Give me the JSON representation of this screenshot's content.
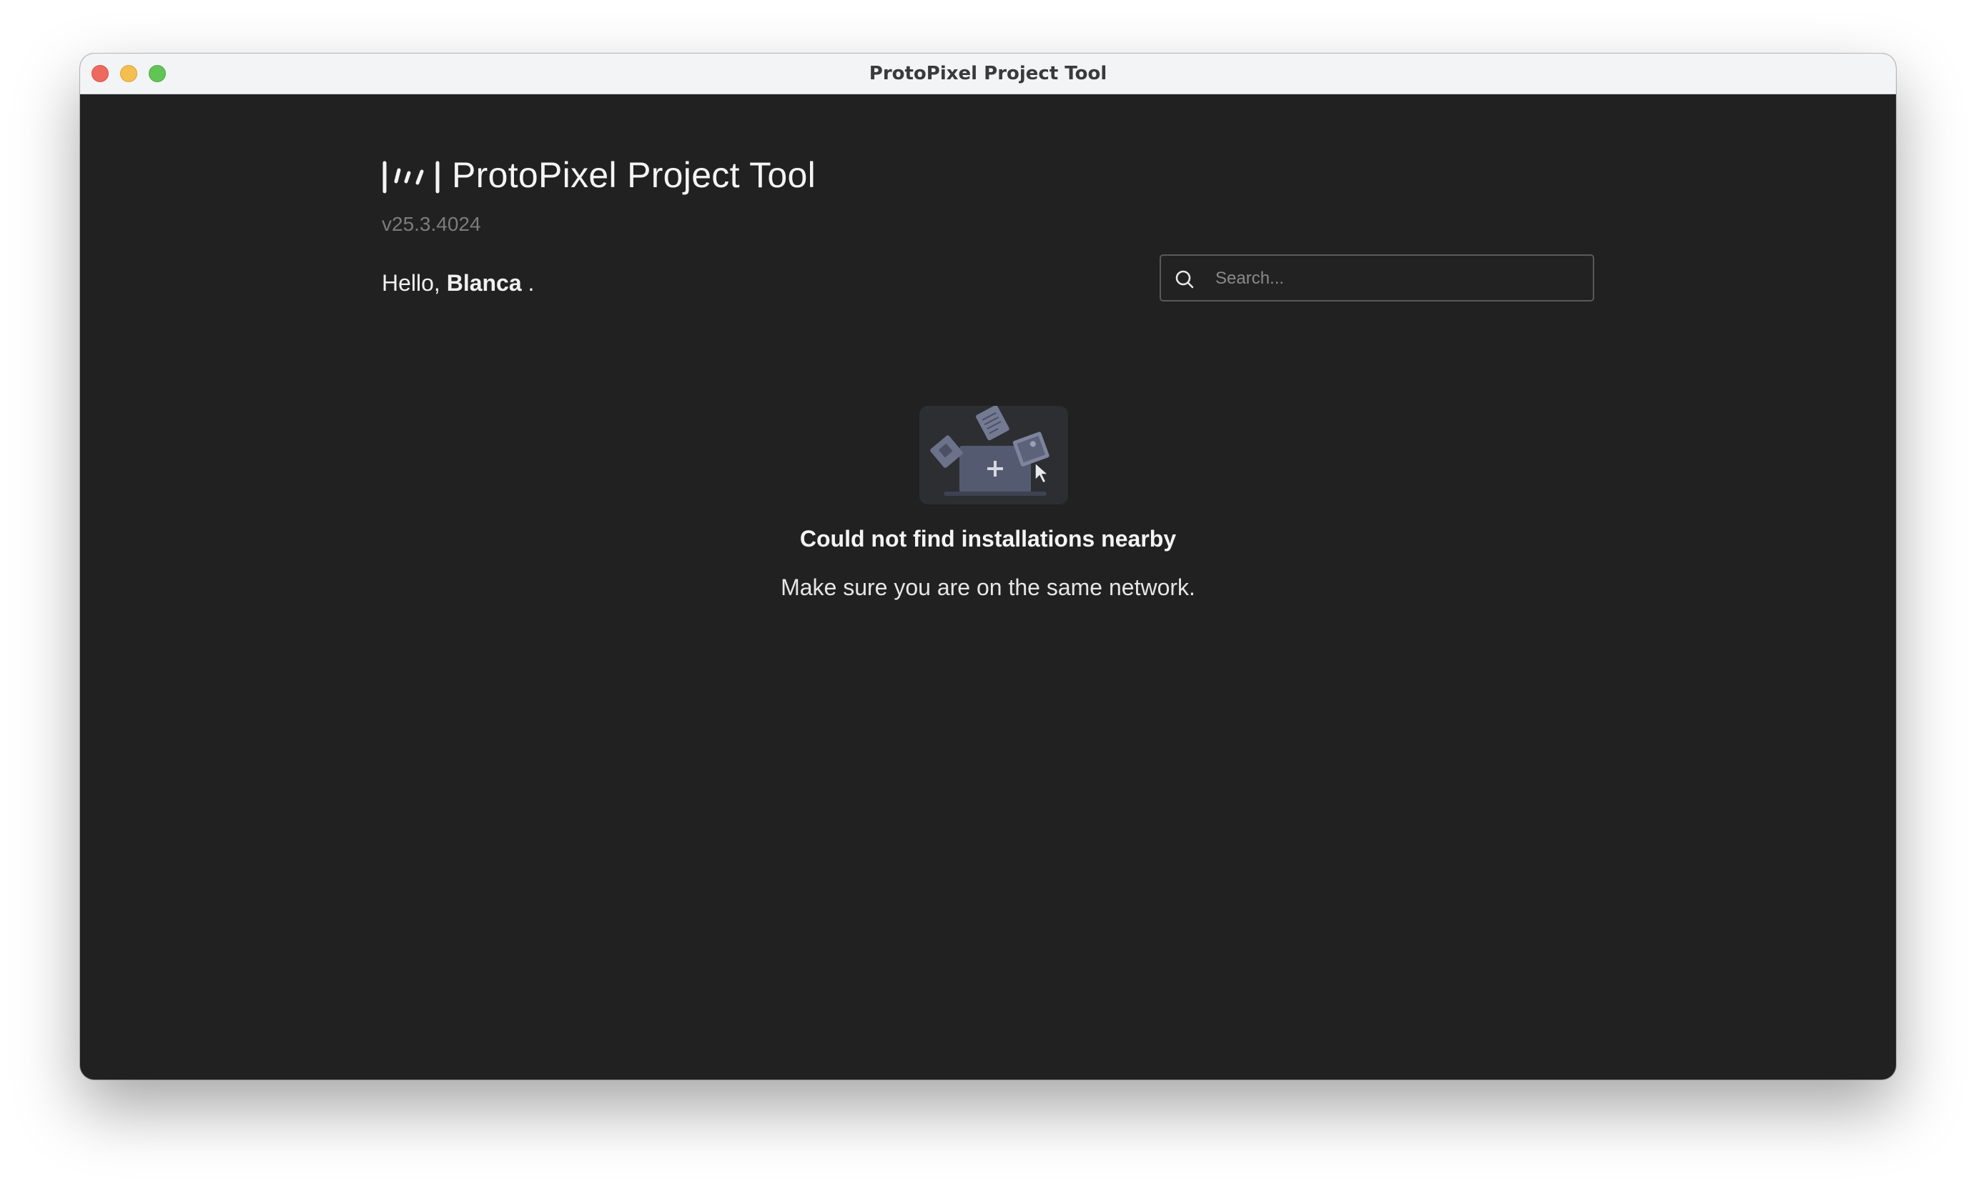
{
  "window": {
    "title": "ProtoPixel Project Tool"
  },
  "header": {
    "app_title": "ProtoPixel Project Tool",
    "version": "v25.3.4024",
    "greeting_prefix": "Hello, ",
    "user_name": "Blanca",
    "greeting_suffix": " ."
  },
  "search": {
    "placeholder": "Search...",
    "value": ""
  },
  "empty_state": {
    "title": "Could not find installations nearby",
    "subtitle": "Make sure you are on the same network."
  },
  "colors": {
    "background": "#212121",
    "titlebar": "#f3f4f6",
    "close": "#ed6a5e",
    "minimize": "#f5bf4f",
    "maximize": "#61c554",
    "muted_text": "#7c7c7c"
  },
  "icons": {
    "logo": "protopixel-logo",
    "search": "search-icon",
    "illustration": "empty-installations-illustration"
  }
}
